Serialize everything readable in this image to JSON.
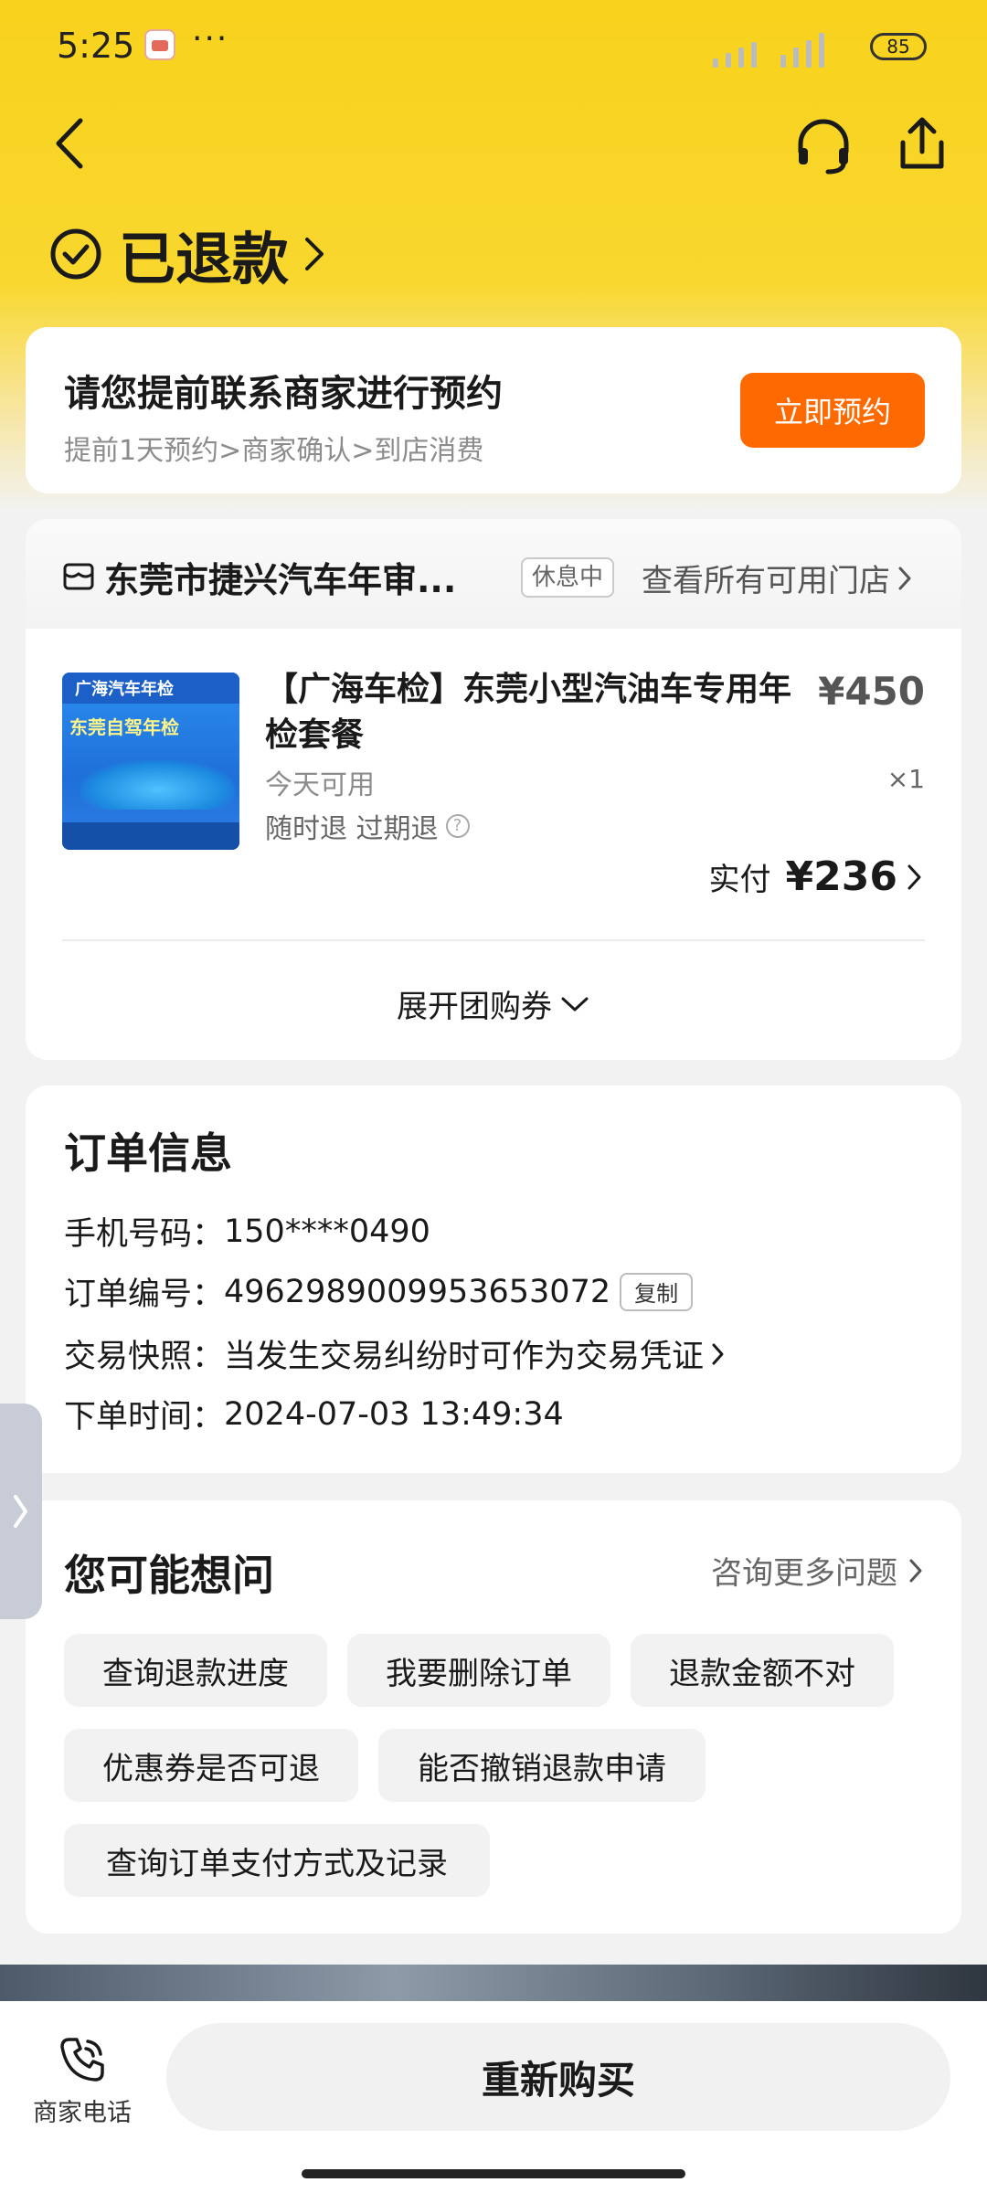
{
  "status_bar": {
    "time": "5:25",
    "more": "···",
    "battery": "85"
  },
  "header": {
    "status_title": "已退款"
  },
  "booking": {
    "title": "请您提前联系商家进行预约",
    "subtitle": "提前1天预约>商家确认>到店消费",
    "button": "立即预约"
  },
  "store": {
    "name": "东莞市捷兴汽车年审...",
    "badge": "休息中",
    "view_all": "查看所有可用门店",
    "product": {
      "title": "【广海车检】东莞小型汽油车专用年检套餐",
      "price": "¥450",
      "availability": "今天可用",
      "quantity": "×1",
      "refund_policy": "随时退 过期退",
      "paid_label": "实付",
      "paid_amount": "¥236",
      "image_brand": "广海汽车年检",
      "image_title": "东莞自驾年检"
    },
    "expand": "展开团购券"
  },
  "order_info": {
    "title": "订单信息",
    "phone_label": "手机号码：",
    "phone": "150****0490",
    "order_no_label": "订单编号：",
    "order_no": "4962989009953653072",
    "copy": "复制",
    "snapshot_label": "交易快照：",
    "snapshot": "当发生交易纠纷时可作为交易凭证",
    "time_label": "下单时间：",
    "time": "2024-07-03 13:49:34"
  },
  "faq": {
    "title": "您可能想问",
    "more": "咨询更多问题",
    "chips": [
      "查询退款进度",
      "我要删除订单",
      "退款金额不对",
      "优惠券是否可退",
      "能否撤销退款申请",
      "查询订单支付方式及记录"
    ]
  },
  "bottom": {
    "phone_label": "商家电话",
    "rebuy": "重新购买"
  }
}
